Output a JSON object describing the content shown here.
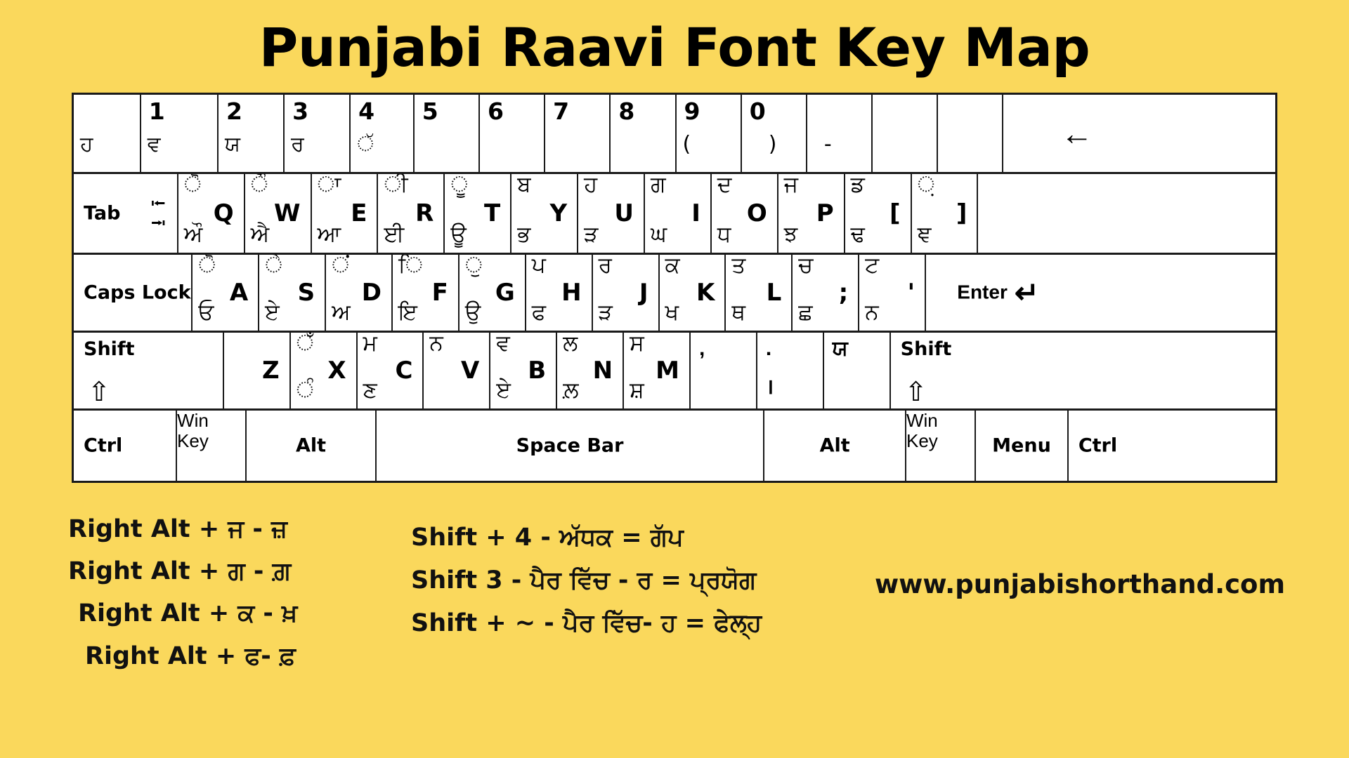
{
  "page": {
    "background_color": "#FAD85C",
    "title": "Punjabi Raavi Font Key Map"
  },
  "keyboard": {
    "number_row": [
      {
        "name": "backtick",
        "digit": "",
        "sub": "ਹ"
      },
      {
        "name": "1",
        "digit": "1",
        "sub": "ਵ"
      },
      {
        "name": "2",
        "digit": "2",
        "sub": "ਯ"
      },
      {
        "name": "3",
        "digit": "3",
        "sub": "ਰ"
      },
      {
        "name": "4",
        "digit": "4",
        "sub": "ੱ"
      },
      {
        "name": "5",
        "digit": "5",
        "sub": ""
      },
      {
        "name": "6",
        "digit": "6",
        "sub": ""
      },
      {
        "name": "7",
        "digit": "7",
        "sub": ""
      },
      {
        "name": "8",
        "digit": "8",
        "sub": ""
      },
      {
        "name": "9",
        "digit": "9",
        "sub": "("
      },
      {
        "name": "0",
        "digit": "0",
        "sub": ")"
      },
      {
        "name": "minus",
        "digit": "",
        "sub": "-"
      },
      {
        "name": "equals",
        "digit": "",
        "sub": ""
      },
      {
        "name": "spare",
        "digit": "",
        "sub": ""
      },
      {
        "name": "backspace",
        "digit": "",
        "sub": "",
        "label": "←"
      }
    ],
    "qwerty_row": {
      "tab_label": "Tab",
      "keys": [
        {
          "latin": "Q",
          "upper": "ੋ",
          "lower": "ਔ"
        },
        {
          "latin": "W",
          "upper": "ੌ",
          "lower": "ਐ"
        },
        {
          "latin": "E",
          "upper": "ਾ",
          "lower": "ਆ"
        },
        {
          "latin": "R",
          "upper": "ੀ",
          "lower": "ਈ"
        },
        {
          "latin": "T",
          "upper": "ੂ",
          "lower": "ਊ"
        },
        {
          "latin": "Y",
          "upper": "ਬ",
          "lower": "ਭ"
        },
        {
          "latin": "U",
          "upper": "ਹ",
          "lower": "ੜ"
        },
        {
          "latin": "I",
          "upper": "ਗ",
          "lower": "ਘ"
        },
        {
          "latin": "O",
          "upper": "ਦ",
          "lower": "ਧ"
        },
        {
          "latin": "P",
          "upper": "ਜ",
          "lower": "ਝ"
        },
        {
          "latin": "[",
          "upper": "ਡ",
          "lower": "ਢ"
        },
        {
          "latin": "]",
          "upper": "਼",
          "lower": "ਞ"
        }
      ]
    },
    "home_row": {
      "caps_label": "Caps Lock",
      "enter_label": "Enter",
      "keys": [
        {
          "latin": "A",
          "upper": "ੋ",
          "lower": "ਓ"
        },
        {
          "latin": "S",
          "upper": "ੇ",
          "lower": "ਏ"
        },
        {
          "latin": "D",
          "upper": "ਂ",
          "lower": "ਅ"
        },
        {
          "latin": "F",
          "upper": "ਿ",
          "lower": "ਇ"
        },
        {
          "latin": "G",
          "upper": "ੁ",
          "lower": "ਉ"
        },
        {
          "latin": "H",
          "upper": "ਪ",
          "lower": "ਫ"
        },
        {
          "latin": "J",
          "upper": "ਰ",
          "lower": "ੜ"
        },
        {
          "latin": "K",
          "upper": "ਕ",
          "lower": "ਖ"
        },
        {
          "latin": "L",
          "upper": "ਤ",
          "lower": "ਥ"
        },
        {
          "latin": ";",
          "upper": "ਚ",
          "lower": "ਛ"
        },
        {
          "latin": "'",
          "upper": "ਟ",
          "lower": "ਨ"
        }
      ]
    },
    "bottom_row": {
      "shift_left_label": "Shift",
      "shift_right_label": "Shift",
      "shift_arrow": "⇧",
      "keys": [
        {
          "latin": "Z",
          "upper": "",
          "lower": ""
        },
        {
          "latin": "X",
          "upper": "ਁ",
          "lower": "ੰ"
        },
        {
          "latin": "C",
          "upper": "ਮ",
          "lower": "ਣ"
        },
        {
          "latin": "V",
          "upper": "ਨ",
          "lower": ""
        },
        {
          "latin": "B",
          "upper": "ਵ",
          "lower": "ਏ"
        },
        {
          "latin": "N",
          "upper": "ਲ",
          "lower": "ਲ਼"
        },
        {
          "latin": "M",
          "upper": "ਸ",
          "lower": "ਸ਼"
        },
        {
          "latin": ",",
          "upper": "",
          "lower": ""
        },
        {
          "latin": ".",
          "upper": ".",
          "lower": "।"
        },
        {
          "latin": "/",
          "upper": "ਯ",
          "lower": ""
        }
      ]
    },
    "space_row": [
      {
        "label": "Ctrl"
      },
      {
        "label": "Win\nKey"
      },
      {
        "label": "Alt"
      },
      {
        "label": "Space Bar"
      },
      {
        "label": "Alt"
      },
      {
        "label": "Win\nKey"
      },
      {
        "label": "Menu"
      },
      {
        "label": "Ctrl"
      }
    ]
  },
  "notes": {
    "left_column": [
      "Right Alt + ਜ - ਜ਼",
      "Right Alt + ਗ - ਗ਼",
      "Right Alt + ਕ - ਖ਼",
      "Right Alt + ਫ- ਫ਼"
    ],
    "middle_column": [
      "Shift + 4 - ਅੱਧਕ = ਗੱਪ",
      "Shift 3 - ਪੈਰ ਵਿੱਚ - ਰ = ਪ੍ਰਯੋਗ",
      "Shift + ~ - ਪੈਰ ਵਿੱਚ- ਹ = ਫੇਲ੍ਹ"
    ],
    "website": "www.punjabishorthand.com"
  }
}
